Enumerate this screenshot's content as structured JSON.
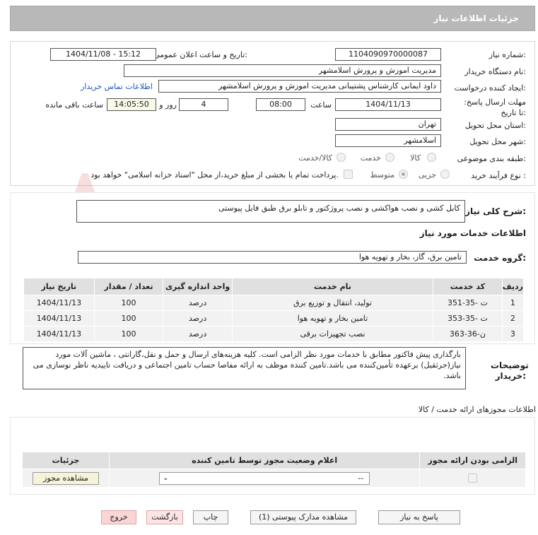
{
  "header": {
    "title": "جزئیات اطلاعات نیاز"
  },
  "form": {
    "need_number_label": "شماره نیاز:",
    "need_number": "1104090970000087",
    "announce_label": "تاریخ و ساعت اعلان عمومی:",
    "announce_value": "1404/11/08 - 15:12",
    "buyer_org_label": "نام دستگاه خریدار:",
    "buyer_org": "مدیریت اموزش و پرورش اسلامشهر",
    "creator_label": "ایجاد کننده درخواست:",
    "creator": "داود ایمانی کارشناس پشتیبانی مدیریت اموزش و پرورش اسلامشهر",
    "contact_link": "اطلاعات تماس خریدار",
    "deadline_label": "مهلت ارسال پاسخ: تا تاریخ:",
    "deadline_date": "1404/11/13",
    "time_label": "ساعت",
    "deadline_time": "08:00",
    "days_value": "4",
    "days_label": "روز و",
    "remaining_time": "14:05:50",
    "remaining_label": "ساعت باقی مانده",
    "province_label": "استان محل تحویل:",
    "province": "تهران",
    "city_label": "شهر محل تحویل:",
    "city": "اسلامشهر",
    "category_label": "طبقه بندی موضوعی:",
    "category_options": [
      "کالا",
      "خدمت",
      "کالا/خدمت"
    ],
    "purchase_type_label": "نوع فرآیند خرید :",
    "purchase_options": [
      "جزیی",
      "متوسط"
    ],
    "treasury_note": "پرداخت تمام یا بخشی از مبلغ خرید،از محل \"اسناد خزانه اسلامی\" خواهد بود."
  },
  "description": {
    "label": "شرح کلی نیاز:",
    "value": "کابل کشی و نصب هواکشی و نصب پروژکتور و تابلو برق طبق فایل پیوستی"
  },
  "services_title": "اطلاعات خدمات مورد نیاز",
  "service_group": {
    "label": "گروه خدمت:",
    "value": "تامین برق، گاز، بخار و تهویه هوا"
  },
  "table": {
    "headers": [
      "ردیف",
      "کد خدمت",
      "نام خدمت",
      "واحد اندازه گیری",
      "تعداد / مقدار",
      "تاریخ نیاز"
    ],
    "rows": [
      [
        "1",
        "ت -35-351",
        "تولید، انتقال و توزیع برق",
        "درصد",
        "100",
        "1404/11/13"
      ],
      [
        "2",
        "ت -35-353",
        "تامین بخار و تهویه هوا",
        "درصد",
        "100",
        "1404/11/13"
      ],
      [
        "3",
        "ن-36-363",
        "نصب تجهیزات برقی",
        "درصد",
        "100",
        "1404/11/13"
      ]
    ]
  },
  "buyer_notes": {
    "label": "توضیحات خریدار:",
    "value": "بارگذاری پیش فاکتور مطابق با خدمات مورد نظر الزامی است. کلیه هزینه‌های ارسال و حمل و نقل،گارانتی ، ماشین آلات مورد نیاز(جرثقیل) برعهده تأمین‌کننده می باشد.تامین کننده موظف به ارائه مفاصا حساب تامین اجتماعی و دریافت تاییدیه ناظر نوسازی می باشد."
  },
  "permits": {
    "title": "اطلاعات مجوزهای ارائه خدمت / کالا",
    "headers": [
      "الزامی بودن ارائه مجوز",
      "اعلام وضعیت مجوز توسط تامین کننده",
      "جزئیات"
    ],
    "select_value": "--",
    "view_button": "مشاهده مجوز"
  },
  "buttons": {
    "reply": "پاسخ به نیاز",
    "attachments": "مشاهده مدارک پیوستی (1)",
    "print": "چاپ",
    "back": "بازگشت",
    "exit": "خروج"
  },
  "watermark": {
    "text": "AriaTender.net"
  },
  "colors": {
    "header_bg": "#b8b8b8",
    "link": "#1a56c4",
    "exit_bg": "#fbd5d5",
    "table_head": "#e0e0e0"
  }
}
